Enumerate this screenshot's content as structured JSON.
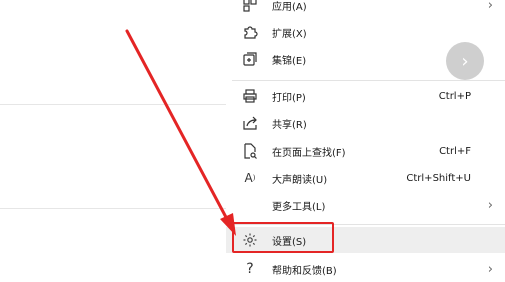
{
  "menu": {
    "items": [
      {
        "label": "应用(A)",
        "shortcut": "",
        "submenu": true,
        "icon": "apps-icon"
      },
      {
        "label": "扩展(X)",
        "shortcut": "",
        "submenu": false,
        "icon": "puzzle-icon"
      },
      {
        "label": "集锦(E)",
        "shortcut": "",
        "submenu": false,
        "icon": "collections-icon"
      },
      {
        "label": "打印(P)",
        "shortcut": "Ctrl+P",
        "submenu": false,
        "icon": "printer-icon"
      },
      {
        "label": "共享(R)",
        "shortcut": "",
        "submenu": false,
        "icon": "share-icon"
      },
      {
        "label": "在页面上查找(F)",
        "shortcut": "Ctrl+F",
        "submenu": false,
        "icon": "find-in-page-icon"
      },
      {
        "label": "大声朗读(U)",
        "shortcut": "Ctrl+Shift+U",
        "submenu": false,
        "icon": "read-aloud-icon"
      },
      {
        "label": "更多工具(L)",
        "shortcut": "",
        "submenu": true,
        "icon": ""
      },
      {
        "label": "设置(S)",
        "shortcut": "",
        "submenu": false,
        "icon": "gear-icon"
      },
      {
        "label": "帮助和反馈(B)",
        "shortcut": "",
        "submenu": true,
        "icon": "help-icon"
      }
    ]
  },
  "colors": {
    "highlight_border": "#e42525",
    "annotation_arrow": "#e42525",
    "hover_background": "#eeeeee"
  }
}
